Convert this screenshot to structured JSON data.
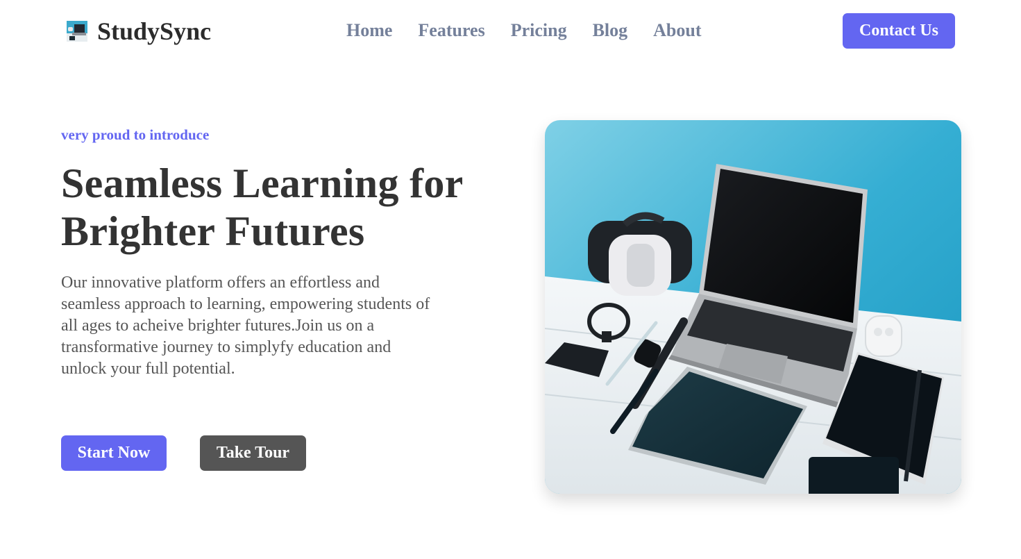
{
  "brand": {
    "name": "StudySync",
    "logo_icon": "desk-devices-logo-icon"
  },
  "nav": {
    "items": [
      {
        "label": "Home"
      },
      {
        "label": "Features"
      },
      {
        "label": "Pricing"
      },
      {
        "label": "Blog"
      },
      {
        "label": "About"
      }
    ],
    "contact_label": "Contact Us"
  },
  "hero": {
    "eyebrow": "very proud to introduce",
    "title_line1": "Seamless Learning for",
    "title_line2": "Brighter Futures",
    "description": "Our innovative platform offers an effortless and seamless approach to learning, empowering students of all ages to acheive brighter futures.Join us on a transformative journey to simplyfy education and unlock your full potential.",
    "primary_cta": "Start Now",
    "secondary_cta": "Take Tour",
    "image": "desk-with-laptop-vr-headset-tablet-notebook-photo"
  },
  "colors": {
    "accent": "#6366f1",
    "nav_text": "#74809a",
    "heading": "#333333",
    "body_text": "#555555",
    "secondary_button": "#555555",
    "photo_wall": "#2aa8cf"
  }
}
